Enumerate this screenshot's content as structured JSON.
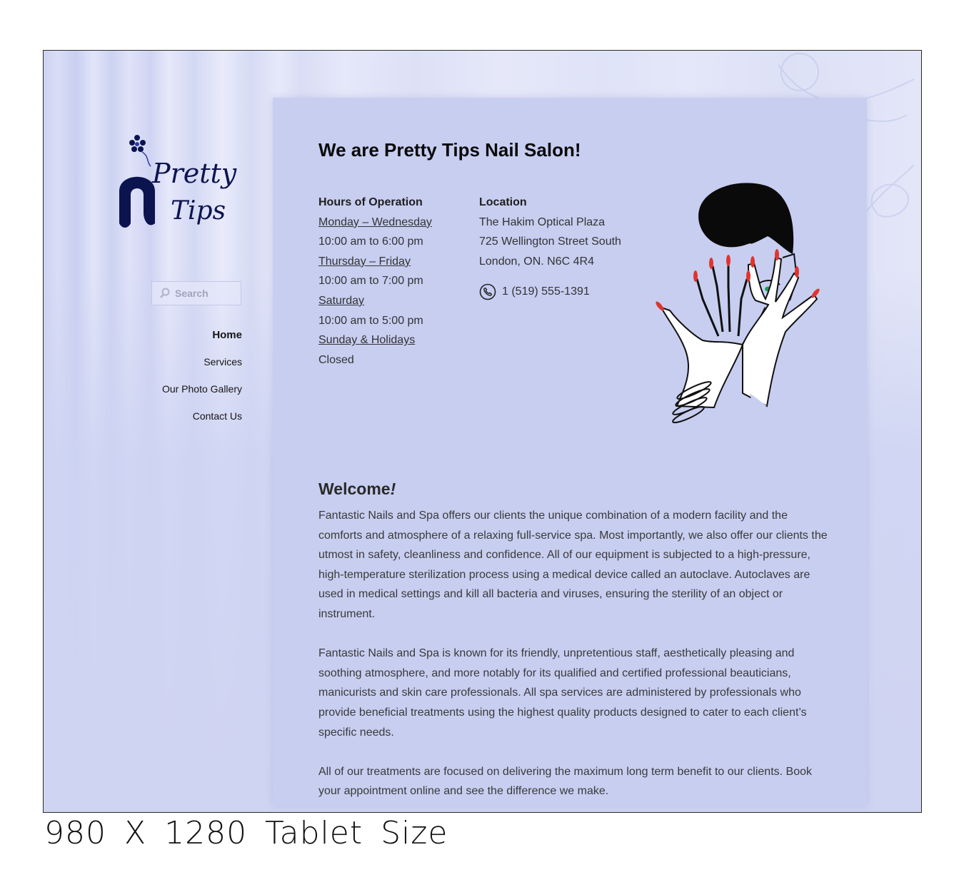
{
  "logo": {
    "line1": "Pretty",
    "line2": "Tips"
  },
  "search": {
    "placeholder": "Search"
  },
  "nav": {
    "items": [
      {
        "label": "Home",
        "active": true
      },
      {
        "label": "Services",
        "active": false
      },
      {
        "label": "Our Photo Gallery",
        "active": false
      },
      {
        "label": "Contact Us",
        "active": false
      }
    ]
  },
  "main": {
    "heading": "We are Pretty Tips Nail Salon!",
    "hours": {
      "title": "Hours of Operation",
      "rows": [
        {
          "day": "Monday – Wednesday",
          "time": "10:00 am to 6:00 pm"
        },
        {
          "day": "Thursday – Friday",
          "time": "10:00 am to 7:00 pm"
        },
        {
          "day": "Saturday",
          "time": "10:00 am to 5:00 pm"
        },
        {
          "day": "Sunday & Holidays",
          "time": "Closed"
        }
      ]
    },
    "location": {
      "title": "Location",
      "lines": [
        "The Hakim Optical Plaza",
        "725 Wellington Street South",
        "London, ON. N6C 4R4"
      ],
      "phone": "1 (519) 555-1391"
    },
    "welcome": {
      "heading": "Welcome",
      "heading_mark": "!",
      "paragraphs": [
        "Fantastic Nails and Spa offers our clients the unique combination of a modern facility and the comforts and atmosphere of a relaxing full-service spa. Most importantly, we also offer our clients the utmost in safety, cleanliness and confidence. All of our equipment is subjected to a high-pressure, high-temperature sterilization process using a medical device called an autoclave. Autoclaves are used in medical settings and kill all bacteria and viruses, ensuring the sterility of an object or instrument.",
        "Fantastic Nails and Spa is known for its friendly, unpretentious staff, aesthetically pleasing and soothing atmosphere, and more notably for its qualified and certified professional beauticians, manicurists and skin care professionals. All spa services are administered by professionals who provide beneficial treatments using the highest quality products designed to cater to each client’s specific needs.",
        "All of our treatments are focused on delivering the maximum long term benefit to our clients. Book your appointment online and see the difference we make."
      ]
    }
  },
  "caption": "980 X 1280 Tablet Size",
  "colors": {
    "panel": "#c8cef0",
    "background": "#dde1f6",
    "nail_polish": "#e0342e",
    "logo": "#0c1450"
  }
}
